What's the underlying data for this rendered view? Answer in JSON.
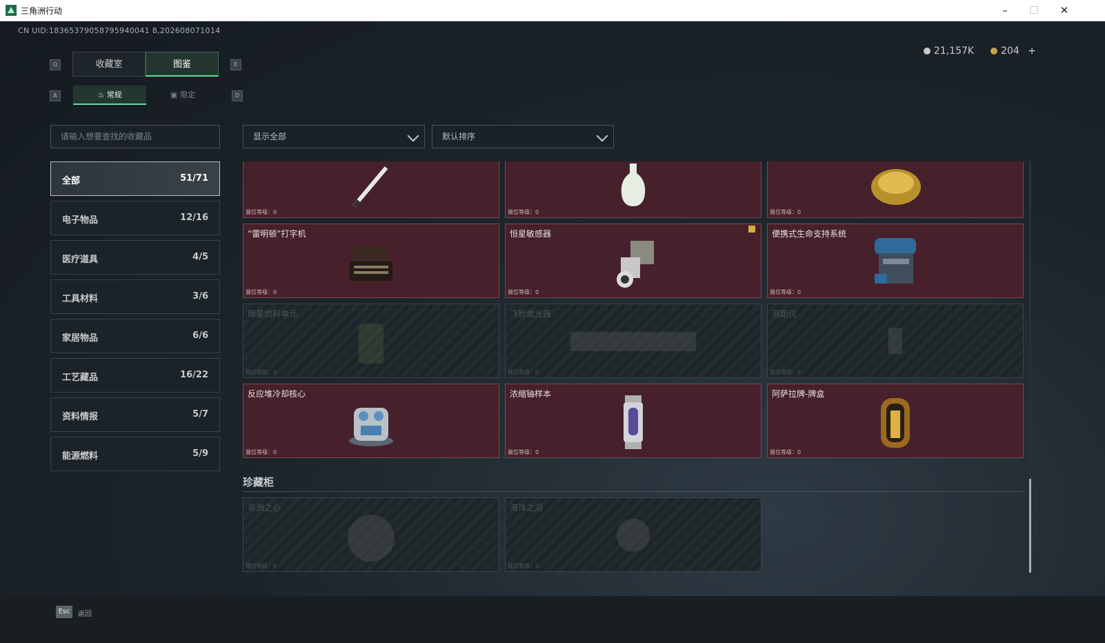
{
  "window": {
    "title": "三角洲行动",
    "minimize": "–",
    "maximize": "☐",
    "close": "✕"
  },
  "uid": "CN UID:18365379058795940041 8,202608071014",
  "currency": {
    "silver": "21,157K",
    "gold": "204",
    "add": "+",
    "silver_color": "#c9c9c9",
    "gold_color": "#c9a34a"
  },
  "keys": {
    "left_tab": "Q",
    "right_tab": "E",
    "left_sub": "A",
    "right_sub": "D"
  },
  "tabs": [
    {
      "label": "收藏室",
      "active": false
    },
    {
      "label": "图鉴",
      "active": true
    }
  ],
  "subtabs": [
    {
      "label": "常规",
      "active": true
    },
    {
      "label": "限定",
      "active": false
    }
  ],
  "search": {
    "placeholder": "请输入想要查找的收藏品"
  },
  "filter": {
    "value": "显示全部"
  },
  "sort": {
    "value": "默认排序"
  },
  "categories": [
    {
      "label": "全部",
      "count": "51/71"
    },
    {
      "label": "电子物品",
      "count": "12/16"
    },
    {
      "label": "医疗道具",
      "count": "4/5"
    },
    {
      "label": "工具材料",
      "count": "3/6"
    },
    {
      "label": "家居物品",
      "count": "6/6"
    },
    {
      "label": "工艺藏品",
      "count": "16/22"
    },
    {
      "label": "资料情报",
      "count": "5/7"
    },
    {
      "label": "能源燃料",
      "count": "5/9"
    }
  ],
  "level_label": "展位等级：0",
  "cards": [
    {
      "name": "",
      "icon": "pen-icon",
      "locked": false
    },
    {
      "name": "",
      "icon": "vase-icon",
      "locked": false
    },
    {
      "name": "",
      "icon": "golden-statue-icon",
      "locked": false
    },
    {
      "name": "“雷明顿”打字机",
      "icon": "typewriter-icon",
      "locked": false
    },
    {
      "name": "恒星敏感器",
      "icon": "star-sensor-icon",
      "locked": false,
      "new": true
    },
    {
      "name": "便携式生命支持系统",
      "icon": "life-support-icon",
      "locked": false
    },
    {
      "name": "暗星燃料单元",
      "icon": "fuel-cell-icon",
      "locked": true
    },
    {
      "name": "飞秒激光器",
      "icon": "laser-icon",
      "locked": true
    },
    {
      "name": "测距仪",
      "icon": "rangefinder-icon",
      "locked": true
    },
    {
      "name": "反应堆冷却核心",
      "icon": "reactor-core-icon",
      "locked": false
    },
    {
      "name": "浓缩铀样本",
      "icon": "uranium-sample-icon",
      "locked": false
    },
    {
      "name": "阿萨拉牌-牌盒",
      "icon": "card-box-icon",
      "locked": false
    }
  ],
  "section": {
    "title": "珍藏柜"
  },
  "treasures": [
    {
      "name": "非洲之心",
      "icon": "gem-icon",
      "locked": true
    },
    {
      "name": "海洋之泪",
      "icon": "tear-gem-icon",
      "locked": true
    }
  ],
  "footer": {
    "esc_key": "Esc",
    "back_label": "返回"
  }
}
